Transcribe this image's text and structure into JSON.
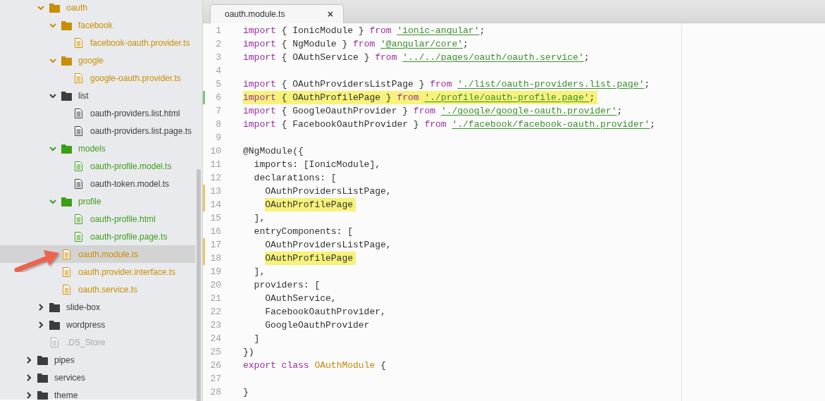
{
  "sidebar": {
    "tree": [
      {
        "kind": "offscreen_folder",
        "children": [
          {
            "kind": "folder",
            "name": "oauth",
            "expanded": true,
            "selected": false,
            "color": "#c98e00",
            "children": [
              {
                "kind": "folder",
                "name": "facebook",
                "expanded": true,
                "selected": false,
                "color": "#c98e00",
                "children": [
                  {
                    "kind": "file",
                    "name": "facebook-oauth.provider.ts",
                    "selected": false,
                    "color": "#c98e00"
                  }
                ]
              },
              {
                "kind": "folder",
                "name": "google",
                "expanded": true,
                "selected": false,
                "color": "#c98e00",
                "children": [
                  {
                    "kind": "file",
                    "name": "google-oauth.provider.ts",
                    "selected": false,
                    "color": "#c98e00"
                  }
                ]
              },
              {
                "kind": "folder",
                "name": "list",
                "expanded": true,
                "selected": false,
                "color": "#3d3d3d",
                "children": [
                  {
                    "kind": "file",
                    "name": "oauth-providers.list.html",
                    "selected": false,
                    "color": "#3d3d3d"
                  },
                  {
                    "kind": "file",
                    "name": "oauth-providers.list.page.ts",
                    "selected": false,
                    "color": "#3d3d3d"
                  }
                ]
              },
              {
                "kind": "folder",
                "name": "models",
                "expanded": true,
                "selected": false,
                "color": "#3e9e1a",
                "children": [
                  {
                    "kind": "file",
                    "name": "oauth-profile.model.ts",
                    "selected": false,
                    "color": "#3e9e1a"
                  },
                  {
                    "kind": "file",
                    "name": "oauth-token.model.ts",
                    "selected": false,
                    "color": "#3d3d3d"
                  }
                ]
              },
              {
                "kind": "folder",
                "name": "profile",
                "expanded": true,
                "selected": false,
                "color": "#3e9e1a",
                "children": [
                  {
                    "kind": "file",
                    "name": "oauth-profile.html",
                    "selected": false,
                    "color": "#3e9e1a"
                  },
                  {
                    "kind": "file",
                    "name": "oauth-profile.page.ts",
                    "selected": false,
                    "color": "#3e9e1a"
                  }
                ]
              },
              {
                "kind": "file",
                "name": "oauth.module.ts",
                "selected": true,
                "color": "#c98e00"
              },
              {
                "kind": "file",
                "name": "oauth.provider.interface.ts",
                "selected": false,
                "color": "#c98e00"
              },
              {
                "kind": "file",
                "name": "oauth.service.ts",
                "selected": false,
                "color": "#c98e00"
              }
            ]
          },
          {
            "kind": "folder",
            "name": "slide-box",
            "expanded": false,
            "selected": false,
            "color": "#3d3d3d"
          },
          {
            "kind": "folder",
            "name": "wordpress",
            "expanded": false,
            "selected": false,
            "color": "#3d3d3d"
          },
          {
            "kind": "file",
            "name": ".DS_Store",
            "selected": false,
            "color": "#a8a8a8"
          }
        ]
      },
      {
        "kind": "folder",
        "name": "pipes",
        "expanded": false,
        "selected": false,
        "color": "#3d3d3d"
      },
      {
        "kind": "folder",
        "name": "services",
        "expanded": false,
        "selected": false,
        "color": "#3d3d3d"
      },
      {
        "kind": "folder",
        "name": "theme",
        "expanded": false,
        "selected": false,
        "color": "#3d3d3d"
      }
    ]
  },
  "editor": {
    "tabs": [
      {
        "title": "oauth.module.ts",
        "close": "×",
        "selected": true
      }
    ],
    "lines": [
      {
        "number": "1",
        "added": false,
        "modified": false,
        "highlight": false,
        "tokens": [
          {
            "text": "import",
            "kind": "keyword"
          },
          {
            "text": " { IonicModule } ",
            "kind": "plain"
          },
          {
            "text": "from ",
            "kind": "keyword"
          },
          {
            "text": "'ionic-angular'",
            "kind": "string"
          },
          {
            "text": ";",
            "kind": "plain"
          }
        ]
      },
      {
        "number": "2",
        "added": false,
        "modified": false,
        "highlight": false,
        "tokens": [
          {
            "text": "import",
            "kind": "keyword"
          },
          {
            "text": " { NgModule } ",
            "kind": "plain"
          },
          {
            "text": "from ",
            "kind": "keyword"
          },
          {
            "text": "'@angular/core'",
            "kind": "string"
          },
          {
            "text": ";",
            "kind": "plain"
          }
        ]
      },
      {
        "number": "3",
        "added": false,
        "modified": false,
        "highlight": false,
        "tokens": [
          {
            "text": "import",
            "kind": "keyword"
          },
          {
            "text": " { OAuthService } ",
            "kind": "plain"
          },
          {
            "text": "from ",
            "kind": "keyword"
          },
          {
            "text": "'../../pages/oauth/oauth.service'",
            "kind": "string"
          },
          {
            "text": ";",
            "kind": "plain"
          }
        ]
      },
      {
        "number": "4",
        "added": false,
        "modified": false,
        "highlight": false
      },
      {
        "number": "5",
        "added": false,
        "modified": false,
        "highlight": false,
        "tokens": [
          {
            "text": "import",
            "kind": "keyword"
          },
          {
            "text": " { OAuthProvidersListPage } ",
            "kind": "plain"
          },
          {
            "text": "from ",
            "kind": "keyword"
          },
          {
            "text": "'./list/oauth-providers.list.page'",
            "kind": "string"
          },
          {
            "text": ";",
            "kind": "plain"
          }
        ]
      },
      {
        "number": "6",
        "added": true,
        "modified": false,
        "highlight": true,
        "tokens": [
          {
            "text": "import",
            "kind": "keyword"
          },
          {
            "text": " { OAuthProfilePage } ",
            "kind": "plain"
          },
          {
            "text": "from ",
            "kind": "keyword"
          },
          {
            "text": "'./profile/oauth-profile.page'",
            "kind": "string"
          },
          {
            "text": ";",
            "kind": "plain"
          }
        ]
      },
      {
        "number": "7",
        "added": false,
        "modified": false,
        "highlight": false,
        "tokens": [
          {
            "text": "import",
            "kind": "keyword"
          },
          {
            "text": " { GoogleOauthProvider } ",
            "kind": "plain"
          },
          {
            "text": "from ",
            "kind": "keyword"
          },
          {
            "text": "'./google/google-oauth.provider'",
            "kind": "string"
          },
          {
            "text": ";",
            "kind": "plain"
          }
        ]
      },
      {
        "number": "8",
        "added": false,
        "modified": false,
        "highlight": false,
        "tokens": [
          {
            "text": "import",
            "kind": "keyword"
          },
          {
            "text": " { FacebookOauthProvider } ",
            "kind": "plain"
          },
          {
            "text": "from ",
            "kind": "keyword"
          },
          {
            "text": "'./facebook/facebook-oauth.provider'",
            "kind": "string"
          },
          {
            "text": ";",
            "kind": "plain"
          }
        ]
      },
      {
        "number": "9",
        "added": false,
        "modified": false,
        "highlight": false
      },
      {
        "number": "10",
        "added": false,
        "modified": false,
        "highlight": false,
        "tokens": [
          {
            "text": "@NgModule({",
            "kind": "plain"
          }
        ],
        "children": [
          {
            "number": "11",
            "added": false,
            "modified": false,
            "highlight": false,
            "tokens": [
              {
                "text": "imports: [IonicModule],",
                "kind": "plain"
              }
            ]
          },
          {
            "number": "12",
            "added": false,
            "modified": false,
            "highlight": false,
            "tokens": [
              {
                "text": "declarations: [",
                "kind": "plain"
              }
            ],
            "children": [
              {
                "number": "13",
                "added": false,
                "modified": true,
                "highlight": false,
                "tokens": [
                  {
                    "text": "OAuthProvidersListPage,",
                    "kind": "plain"
                  }
                ]
              },
              {
                "number": "14",
                "added": false,
                "modified": true,
                "highlight": true,
                "tokens": [
                  {
                    "text": "OAuthProfilePage",
                    "kind": "plain"
                  }
                ]
              }
            ]
          },
          {
            "number": "15",
            "added": false,
            "modified": false,
            "highlight": false,
            "tokens": [
              {
                "text": "],",
                "kind": "plain"
              }
            ]
          },
          {
            "number": "16",
            "added": false,
            "modified": false,
            "highlight": false,
            "tokens": [
              {
                "text": "entryComponents: [",
                "kind": "plain"
              }
            ],
            "children": [
              {
                "number": "17",
                "added": false,
                "modified": true,
                "highlight": false,
                "tokens": [
                  {
                    "text": "OAuthProvidersListPage,",
                    "kind": "plain"
                  }
                ]
              },
              {
                "number": "18",
                "added": false,
                "modified": true,
                "highlight": true,
                "tokens": [
                  {
                    "text": "OAuthProfilePage",
                    "kind": "plain"
                  }
                ]
              }
            ]
          },
          {
            "number": "19",
            "added": false,
            "modified": false,
            "highlight": false,
            "tokens": [
              {
                "text": "],",
                "kind": "plain"
              }
            ]
          },
          {
            "number": "20",
            "added": false,
            "modified": false,
            "highlight": false,
            "tokens": [
              {
                "text": "providers: [",
                "kind": "plain"
              }
            ],
            "children": [
              {
                "number": "21",
                "added": false,
                "modified": false,
                "highlight": false,
                "tokens": [
                  {
                    "text": "OAuthService,",
                    "kind": "plain"
                  }
                ]
              },
              {
                "number": "22",
                "added": false,
                "modified": false,
                "highlight": false,
                "tokens": [
                  {
                    "text": "FacebookOauthProvider,",
                    "kind": "plain"
                  }
                ]
              },
              {
                "number": "23",
                "added": false,
                "modified": false,
                "highlight": false,
                "tokens": [
                  {
                    "text": "GoogleOauthProvider",
                    "kind": "plain"
                  }
                ]
              }
            ]
          },
          {
            "number": "24",
            "added": false,
            "modified": false,
            "highlight": false,
            "tokens": [
              {
                "text": "]",
                "kind": "plain"
              }
            ]
          }
        ]
      },
      {
        "number": "25",
        "added": false,
        "modified": false,
        "highlight": false,
        "tokens": [
          {
            "text": "})",
            "kind": "plain"
          }
        ]
      },
      {
        "number": "26",
        "added": false,
        "modified": false,
        "highlight": false,
        "tokens": [
          {
            "text": "export class ",
            "kind": "keyword"
          },
          {
            "text": "OAuthModule",
            "kind": "class"
          },
          {
            "text": " {",
            "kind": "plain"
          }
        ]
      },
      {
        "number": "27",
        "added": false,
        "modified": false,
        "highlight": false
      },
      {
        "number": "28",
        "added": false,
        "modified": false,
        "highlight": false,
        "tokens": [
          {
            "text": "}",
            "kind": "plain"
          }
        ]
      }
    ]
  }
}
